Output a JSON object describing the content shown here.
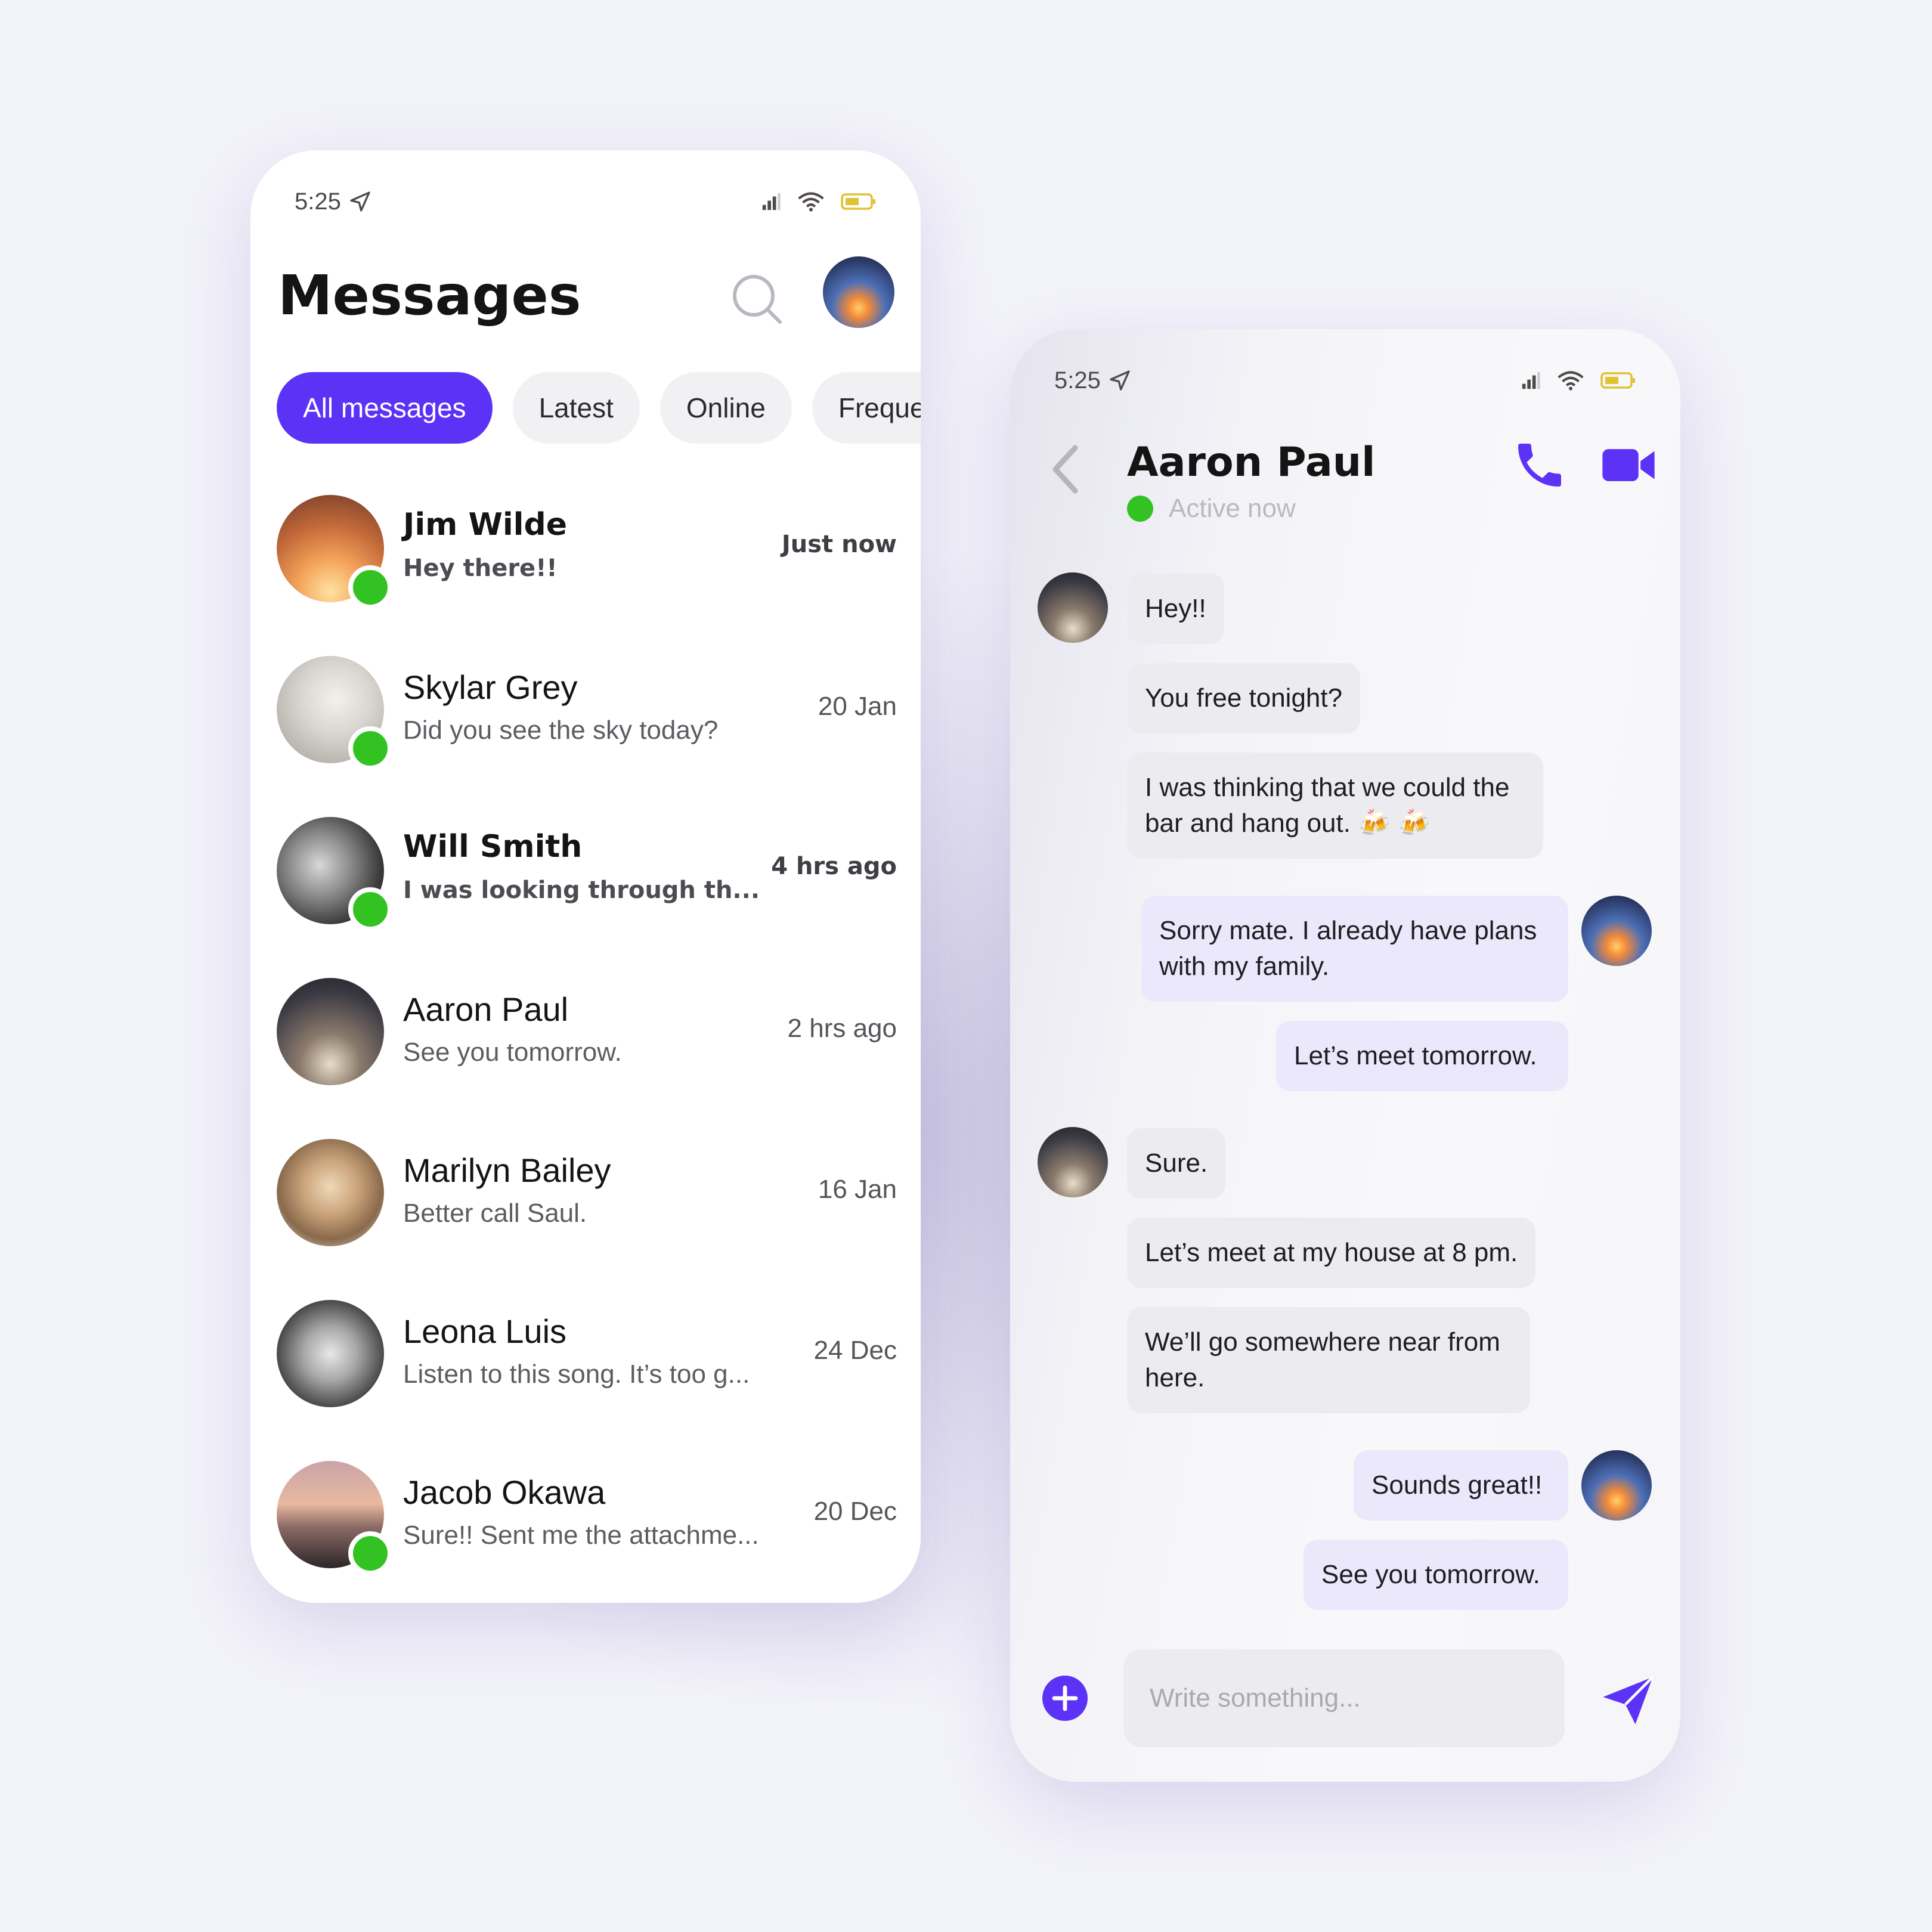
{
  "colors": {
    "accent": "#5c33f6",
    "online": "#32c322",
    "bubble_in": "#ececf0",
    "bubble_out": "#ece8fb"
  },
  "status_bar": {
    "time": "5:25"
  },
  "list_screen": {
    "title": "Messages",
    "filters": [
      {
        "label": "All messages",
        "active": true
      },
      {
        "label": "Latest",
        "active": false
      },
      {
        "label": "Online",
        "active": false
      },
      {
        "label": "Frequen",
        "active": false
      }
    ],
    "conversations": [
      {
        "name": "Jim Wilde",
        "preview": "Hey there!!",
        "time": "Just now",
        "unread": true,
        "online": true
      },
      {
        "name": "Skylar Grey",
        "preview": "Did you see the sky today?",
        "time": "20 Jan",
        "unread": false,
        "online": true
      },
      {
        "name": "Will Smith",
        "preview": "I was looking through th...",
        "time": "4 hrs ago",
        "unread": true,
        "online": true
      },
      {
        "name": "Aaron Paul",
        "preview": "See you tomorrow.",
        "time": "2 hrs ago",
        "unread": false,
        "online": false
      },
      {
        "name": "Marilyn Bailey",
        "preview": "Better call Saul.",
        "time": "16 Jan",
        "unread": false,
        "online": false
      },
      {
        "name": "Leona Luis",
        "preview": "Listen to this song. It’s too g...",
        "time": "24 Dec",
        "unread": false,
        "online": false
      },
      {
        "name": "Jacob Okawa",
        "preview": "Sure!! Sent me the attachme...",
        "time": "20 Dec",
        "unread": false,
        "online": true
      }
    ]
  },
  "chat_screen": {
    "contact_name": "Aaron Paul",
    "presence": "Active now",
    "messages": [
      {
        "from": "them",
        "text": "Hey!!"
      },
      {
        "from": "them",
        "text": "You free tonight?"
      },
      {
        "from": "them",
        "text": "I was thinking that we could the bar and hang out. 🍻 🍻"
      },
      {
        "from": "me",
        "text": "Sorry mate. I already have plans with my family."
      },
      {
        "from": "me",
        "text": "Let’s meet tomorrow."
      },
      {
        "from": "them",
        "text": "Sure."
      },
      {
        "from": "them",
        "text": "Let’s meet at my house at 8 pm."
      },
      {
        "from": "them",
        "text": "We’ll go somewhere near from here."
      },
      {
        "from": "me",
        "text": "Sounds great!!"
      },
      {
        "from": "me",
        "text": "See you tomorrow."
      }
    ],
    "composer_placeholder": "Write something..."
  }
}
